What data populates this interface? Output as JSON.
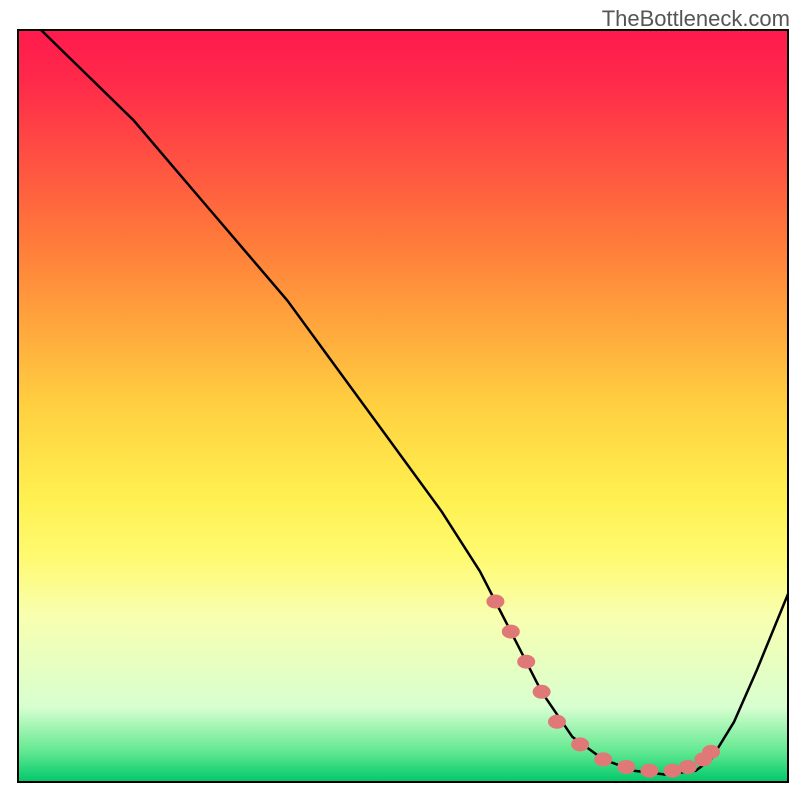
{
  "watermark": "TheBottleneck.com",
  "chart_data": {
    "type": "line",
    "title": "",
    "xlabel": "",
    "ylabel": "",
    "xlim": [
      0,
      100
    ],
    "ylim": [
      0,
      100
    ],
    "background_gradient": {
      "stops": [
        {
          "offset": 0.0,
          "color": "#ff1a4d"
        },
        {
          "offset": 0.07,
          "color": "#ff2a4a"
        },
        {
          "offset": 0.28,
          "color": "#ff7a3a"
        },
        {
          "offset": 0.5,
          "color": "#ffd040"
        },
        {
          "offset": 0.62,
          "color": "#fff050"
        },
        {
          "offset": 0.7,
          "color": "#fffa70"
        },
        {
          "offset": 0.78,
          "color": "#f8ffb0"
        },
        {
          "offset": 0.9,
          "color": "#d8ffd0"
        },
        {
          "offset": 0.96,
          "color": "#60e890"
        },
        {
          "offset": 1.0,
          "color": "#00c86a"
        }
      ]
    },
    "series": [
      {
        "name": "bottleneck-curve",
        "type": "line",
        "color": "#000000",
        "x": [
          3,
          6,
          10,
          15,
          20,
          25,
          30,
          35,
          40,
          45,
          50,
          55,
          60,
          62,
          65,
          68,
          72,
          76,
          80,
          84,
          88,
          90,
          93,
          96,
          100
        ],
        "y": [
          100,
          97,
          93,
          88,
          82,
          76,
          70,
          64,
          57,
          50,
          43,
          36,
          28,
          24,
          18,
          12,
          6,
          3,
          1.5,
          1,
          1.5,
          3,
          8,
          15,
          25
        ]
      },
      {
        "name": "highlight-dots",
        "type": "scatter",
        "color": "#e07878",
        "x": [
          62,
          64,
          66,
          68,
          70,
          73,
          76,
          79,
          82,
          85,
          87,
          89,
          90
        ],
        "y": [
          24,
          20,
          16,
          12,
          8,
          5,
          3,
          2,
          1.5,
          1.5,
          2,
          3,
          4
        ]
      }
    ]
  }
}
